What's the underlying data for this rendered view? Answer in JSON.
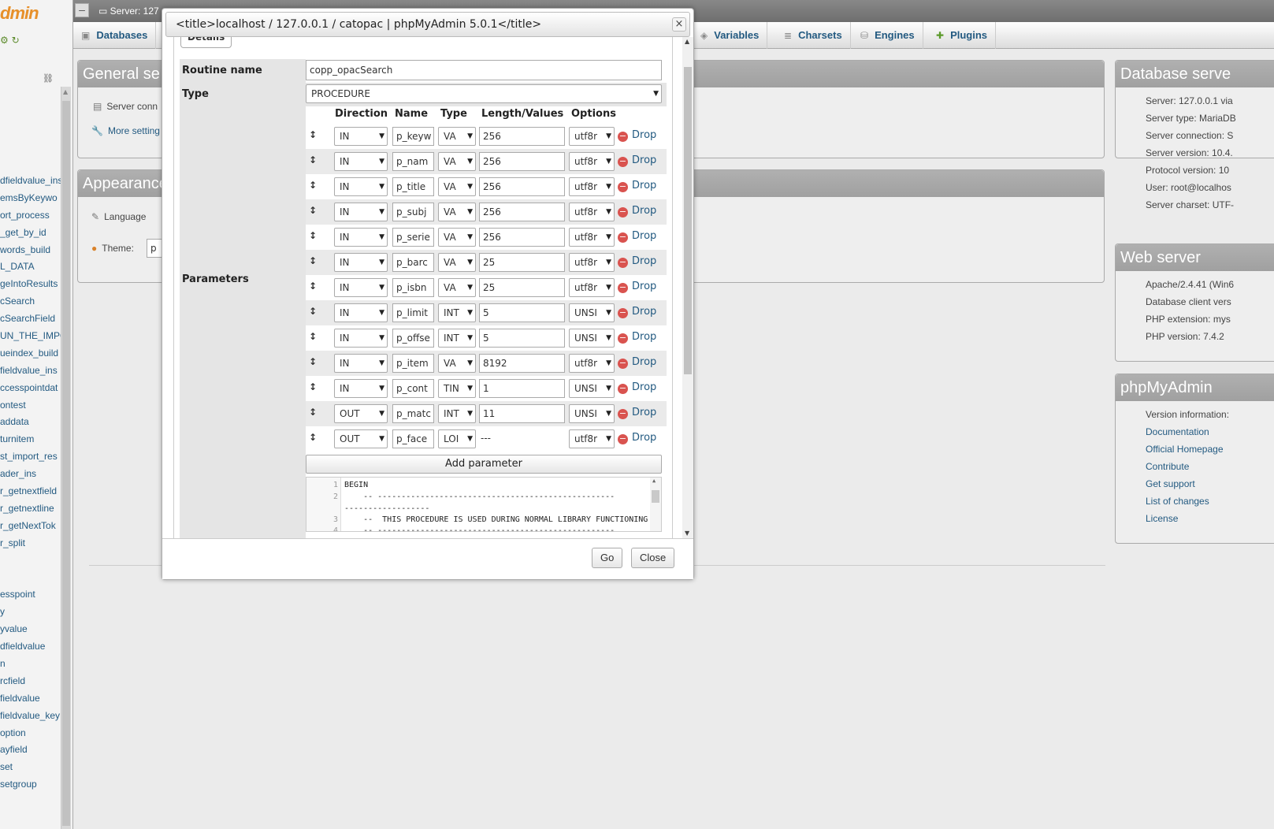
{
  "app": {
    "logo_text": "dmin",
    "logo_icons": "⚙ ↻"
  },
  "nav": {
    "link_icon": "link-icon",
    "items": [
      "dfieldvalue_ins",
      "emsByKeywo",
      "ort_process",
      "_get_by_id",
      "words_build",
      "L_DATA",
      "geIntoResults",
      "cSearch",
      "cSearchField",
      "UN_THE_IMPO",
      "ueindex_build",
      "fieldvalue_ins",
      "ccesspointdat",
      "ontest",
      "addata",
      "turnitem",
      "st_import_res",
      "ader_ins",
      "r_getnextfield",
      "r_getnextline",
      "r_getNextTok",
      "r_split",
      "",
      "",
      "esspoint",
      "y",
      "yvalue",
      "dfieldvalue",
      "n",
      "rcfield",
      "fieldvalue",
      "fieldvalue_key",
      "option",
      "ayfield",
      "set",
      "setgroup"
    ]
  },
  "serverbar": {
    "breadcrumb": "Server: 127"
  },
  "topmenu": {
    "databases": "Databases",
    "variables": "Variables",
    "charsets": "Charsets",
    "engines": "Engines",
    "plugins": "Plugins"
  },
  "general": {
    "title": "General se",
    "server_conn": "Server conn",
    "more_settings": "More setting"
  },
  "appearance": {
    "title": "Appearance",
    "language": "Language",
    "theme": "Theme:",
    "theme_value": "p"
  },
  "database_server": {
    "title": "Database serve",
    "items": [
      "Server: 127.0.0.1 via",
      "Server type: MariaDB",
      "Server connection: S",
      "Server version: 10.4.",
      "Protocol version: 10",
      "User: root@localhos",
      "Server charset: UTF-"
    ]
  },
  "web_server": {
    "title": "Web server",
    "items": [
      "Apache/2.4.41 (Win6",
      "Database client vers",
      "PHP extension: mys",
      "PHP version: 7.4.2"
    ]
  },
  "phpmyadmin": {
    "title": "phpMyAdmin",
    "items": [
      "Version information:",
      "Documentation",
      "Official Homepage",
      "Contribute",
      "Get support",
      "List of changes",
      "License"
    ]
  },
  "dialog": {
    "title": "<title>localhost / 127.0.0.1 / catopac | phpMyAdmin 5.0.1</title>",
    "close_glyph": "×",
    "legend": "Details",
    "routine_name_label": "Routine name",
    "routine_name_value": "copp_opacSearch",
    "type_label": "Type",
    "type_value": "PROCEDURE",
    "parameters_label": "Parameters",
    "headers": {
      "direction": "Direction",
      "name": "Name",
      "type": "Type",
      "length": "Length/Values",
      "options": "Options"
    },
    "drop_label": "Drop",
    "params": [
      {
        "dir": "IN",
        "name": "p_keyw",
        "type": "VA",
        "length": "256",
        "opt": "utf8r"
      },
      {
        "dir": "IN",
        "name": "p_nam",
        "type": "VA",
        "length": "256",
        "opt": "utf8r"
      },
      {
        "dir": "IN",
        "name": "p_title",
        "type": "VA",
        "length": "256",
        "opt": "utf8r"
      },
      {
        "dir": "IN",
        "name": "p_subj",
        "type": "VA",
        "length": "256",
        "opt": "utf8r"
      },
      {
        "dir": "IN",
        "name": "p_serie",
        "type": "VA",
        "length": "256",
        "opt": "utf8r"
      },
      {
        "dir": "IN",
        "name": "p_barc",
        "type": "VA",
        "length": "25",
        "opt": "utf8r"
      },
      {
        "dir": "IN",
        "name": "p_isbn",
        "type": "VA",
        "length": "25",
        "opt": "utf8r"
      },
      {
        "dir": "IN",
        "name": "p_limit",
        "type": "INT",
        "length": "5",
        "opt": "UNSI"
      },
      {
        "dir": "IN",
        "name": "p_offse",
        "type": "INT",
        "length": "5",
        "opt": "UNSI"
      },
      {
        "dir": "IN",
        "name": "p_item",
        "type": "VA",
        "length": "8192",
        "opt": "utf8r"
      },
      {
        "dir": "IN",
        "name": "p_cont",
        "type": "TIN",
        "length": "1",
        "opt": "UNSI"
      },
      {
        "dir": "OUT",
        "name": "p_matc",
        "type": "INT",
        "length": "11",
        "opt": "UNSI"
      },
      {
        "dir": "OUT",
        "name": "p_face",
        "type": "LOI",
        "length": "---",
        "opt": "utf8r"
      }
    ],
    "add_parameter": "Add parameter",
    "code": [
      {
        "num": "1",
        "text": "BEGIN"
      },
      {
        "num": "2",
        "text": "    -- --------------------------------------------------"
      },
      {
        "num": "",
        "text": "------------------"
      },
      {
        "num": "3",
        "text": "    --  THIS PROCEDURE IS USED DURING NORMAL LIBRARY FUNCTIONING"
      },
      {
        "num": "4",
        "text": "    -- --------------------------------------------------"
      }
    ],
    "go": "Go",
    "close": "Close"
  }
}
